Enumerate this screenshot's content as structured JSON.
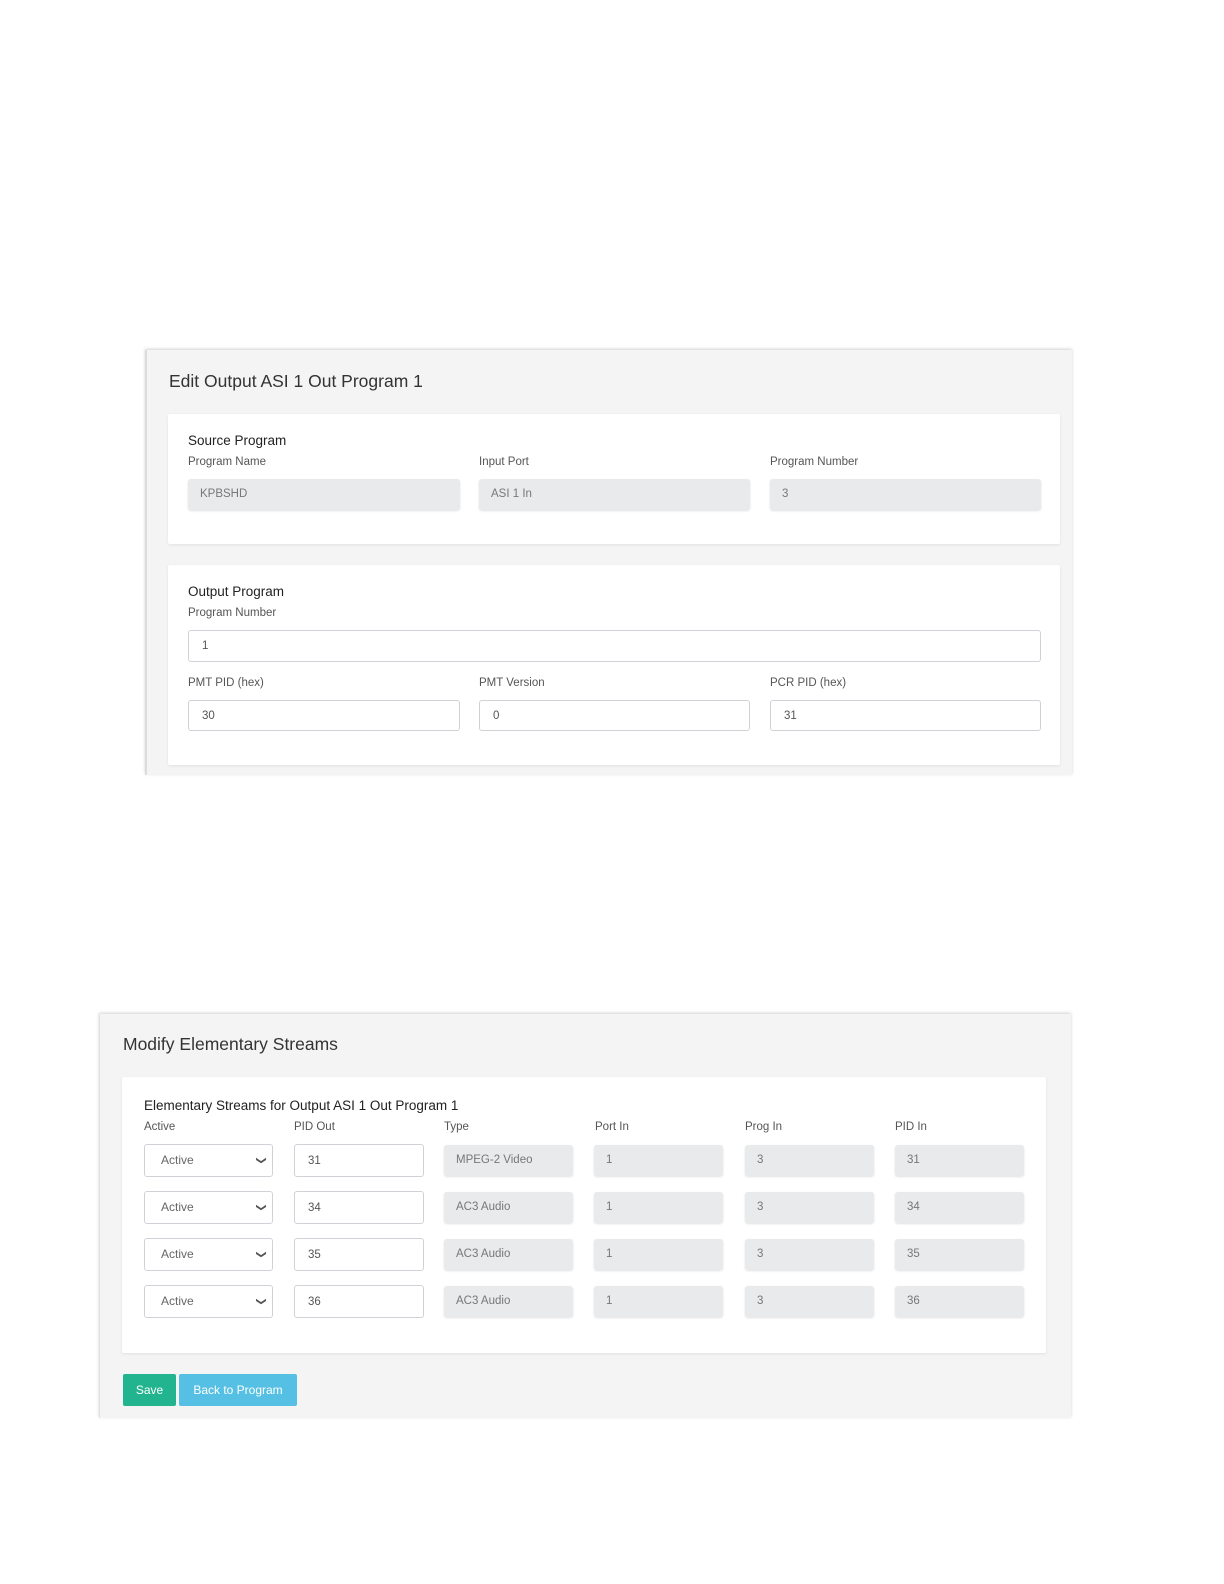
{
  "edit_panel": {
    "title": "Edit Output ASI 1 Out Program 1",
    "source": {
      "title": "Source Program",
      "program_name_label": "Program Name",
      "program_name_value": "KPBSHD",
      "input_port_label": "Input Port",
      "input_port_value": "ASI 1 In",
      "program_number_label": "Program Number",
      "program_number_value": "3"
    },
    "output": {
      "title": "Output Program",
      "program_number_label": "Program Number",
      "program_number_value": "1",
      "pmt_pid_label": "PMT PID (hex)",
      "pmt_pid_value": "30",
      "pmt_version_label": "PMT Version",
      "pmt_version_value": "0",
      "pcr_pid_label": "PCR PID (hex)",
      "pcr_pid_value": "31"
    }
  },
  "streams_panel": {
    "title": "Modify Elementary Streams",
    "card_title": "Elementary Streams for Output ASI 1 Out Program 1",
    "columns": [
      "Active",
      "PID Out",
      "Type",
      "Port In",
      "Prog In",
      "PID In"
    ],
    "rows": [
      {
        "active": "Active",
        "pid_out": "31",
        "type": "MPEG-2 Video",
        "port_in": "1",
        "prog_in": "3",
        "pid_in": "31"
      },
      {
        "active": "Active",
        "pid_out": "34",
        "type": "AC3 Audio",
        "port_in": "1",
        "prog_in": "3",
        "pid_in": "34"
      },
      {
        "active": "Active",
        "pid_out": "35",
        "type": "AC3 Audio",
        "port_in": "1",
        "prog_in": "3",
        "pid_in": "35"
      },
      {
        "active": "Active",
        "pid_out": "36",
        "type": "AC3 Audio",
        "port_in": "1",
        "prog_in": "3",
        "pid_in": "36"
      }
    ],
    "save_label": "Save",
    "back_label": "Back to Program"
  },
  "colors": {
    "save": "#21b48f",
    "back": "#55c0e3",
    "readonly_bg": "#e9eaec",
    "panel_bg": "#f4f4f4"
  },
  "icons": {
    "select_chevron": "chevron-down-icon"
  }
}
